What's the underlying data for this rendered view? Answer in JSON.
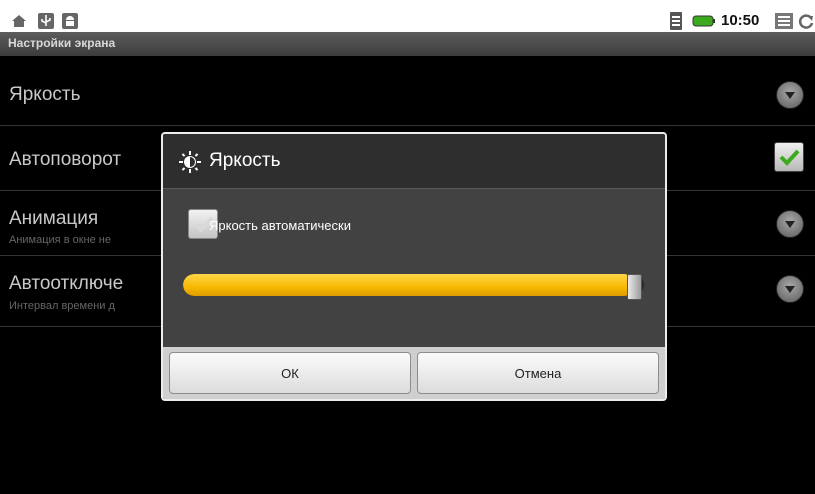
{
  "status_bar": {
    "time": "10:50",
    "icons": [
      "home-icon",
      "usb-icon",
      "android-debug-icon",
      "sim-icon",
      "battery-icon",
      "menu-icon",
      "refresh-icon"
    ]
  },
  "screen_title": "Настройки экрана",
  "settings": [
    {
      "title": "Яркость",
      "subtitle": "",
      "control": "radio-arrow"
    },
    {
      "title": "Автоповорот",
      "subtitle": "",
      "control": "checkbox-checked"
    },
    {
      "title": "Анимация",
      "subtitle": "Анимация в окне не",
      "control": "radio-arrow"
    },
    {
      "title": "Автоотключе",
      "subtitle": "Интервал времени д",
      "control": "radio-arrow"
    }
  ],
  "dialog": {
    "title": "Яркость",
    "title_icon": "brightness-icon",
    "auto_label": "Яркость автоматически",
    "auto_checked": true,
    "brightness_fraction": 0.98,
    "ok_label": "ОК",
    "cancel_label": "Отмена"
  },
  "colors": {
    "accent_yellow": "#f7b800",
    "check_green": "#3caa1e",
    "background": "#000000"
  }
}
